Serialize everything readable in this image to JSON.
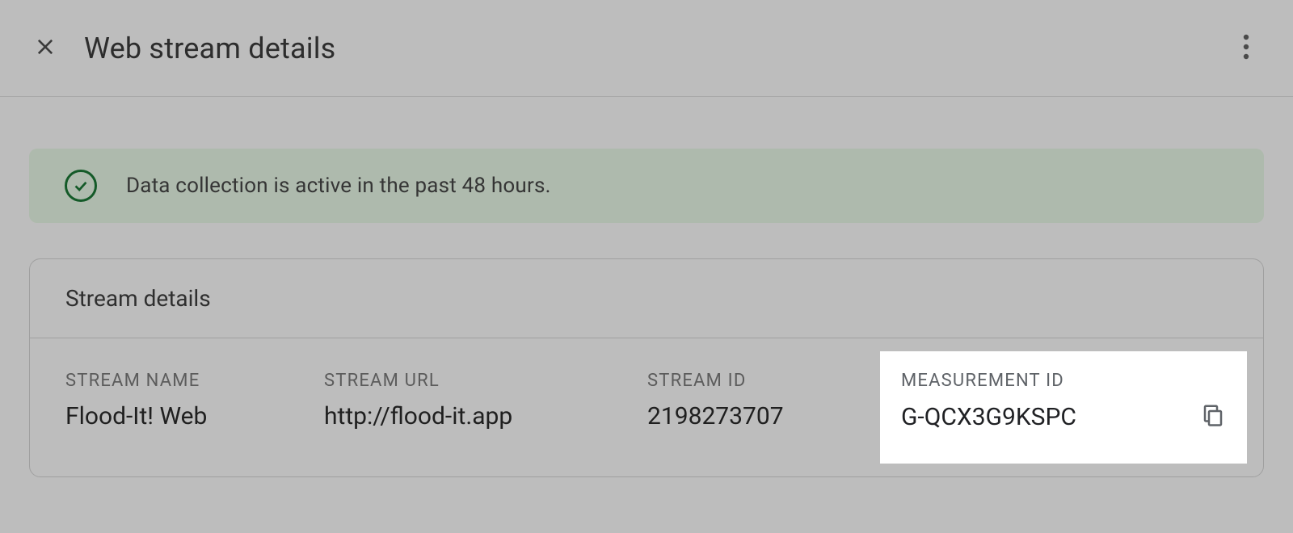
{
  "header": {
    "title": "Web stream details"
  },
  "status": {
    "message": "Data collection is active in the past 48 hours."
  },
  "card": {
    "title": "Stream details",
    "fields": {
      "stream_name": {
        "label": "STREAM NAME",
        "value": "Flood-It! Web"
      },
      "stream_url": {
        "label": "STREAM URL",
        "value": "http://flood-it.app"
      },
      "stream_id": {
        "label": "STREAM ID",
        "value": "2198273707"
      },
      "measurement_id": {
        "label": "MEASUREMENT ID",
        "value": "G-QCX3G9KSPC"
      }
    }
  }
}
